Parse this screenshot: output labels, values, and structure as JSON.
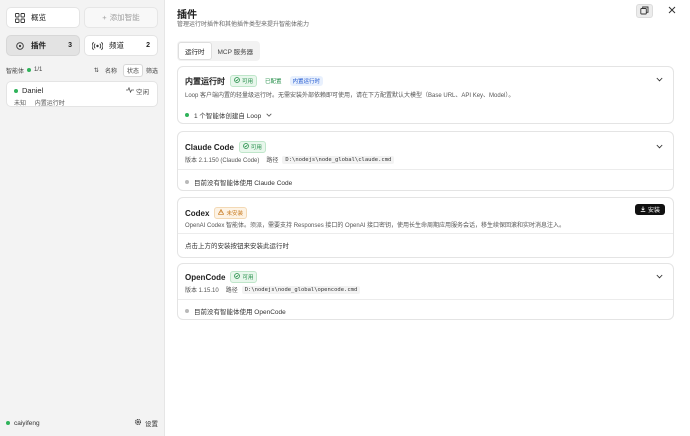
{
  "sidebar": {
    "overview_label": "概览",
    "add_agent_label": "添加智能",
    "plugins_label": "插件",
    "plugins_count": "3",
    "channels_label": "频道",
    "channels_count": "2",
    "agents_label": "智能体",
    "agents_count": "1/1",
    "name_sort_label": "名称",
    "status_sort_label": "状态",
    "filter_label": "筛选",
    "agent": {
      "name": "Daniel",
      "status": "空闲",
      "meta_left": "未知",
      "meta_right": "内置运行时"
    },
    "user_name": "caiyifeng",
    "settings_label": "设置"
  },
  "header": {
    "title": "插件",
    "subtitle": "管理运行时插件和其他插件类型来提升智能体能力"
  },
  "tabs": [
    "运行时",
    "MCP 服务器"
  ],
  "cards": {
    "builtin": {
      "title": "内置运行时",
      "badge_available": "可用",
      "badge_configured": "已配置",
      "badge_builtin": "内置运行时",
      "desc": "Loop 客户端内置的轻量级运行时。无需安装外部依赖即可使用，请在下方配置默认大模型（Base URL、API Key、Model）。",
      "footer": "1 个智能体创建自 Loop"
    },
    "claude": {
      "title": "Claude Code",
      "badge_available": "可用",
      "version_label": "版本 2.1.150 (Claude Code)",
      "path_label": "路径",
      "path": "D:\\nodejs\\node_global\\claude.cmd",
      "footer": "目前没有智能体使用 Claude Code"
    },
    "codex": {
      "title": "Codex",
      "badge_not_installed": "未安装",
      "desc": "OpenAI Codex 智能体。须派，需要支持 Responses 接口的 OpenAI 接口密钥，使用长生命周期应用服务会话，移生续保回滚和实时消息注入。",
      "install_label": "安装",
      "footer": "点击上方的安装按钮来安装此运行时"
    },
    "opencode": {
      "title": "OpenCode",
      "badge_available": "可用",
      "version_label": "版本 1.15.10",
      "path_label": "路径",
      "path": "D:\\nodejs\\node_global\\opencode.cmd",
      "footer": "目前没有智能体使用 OpenCode"
    }
  },
  "colors": {
    "accent_green": "#2fb35a",
    "badge_blue": "#2158d0",
    "badge_orange": "#c7781d"
  }
}
